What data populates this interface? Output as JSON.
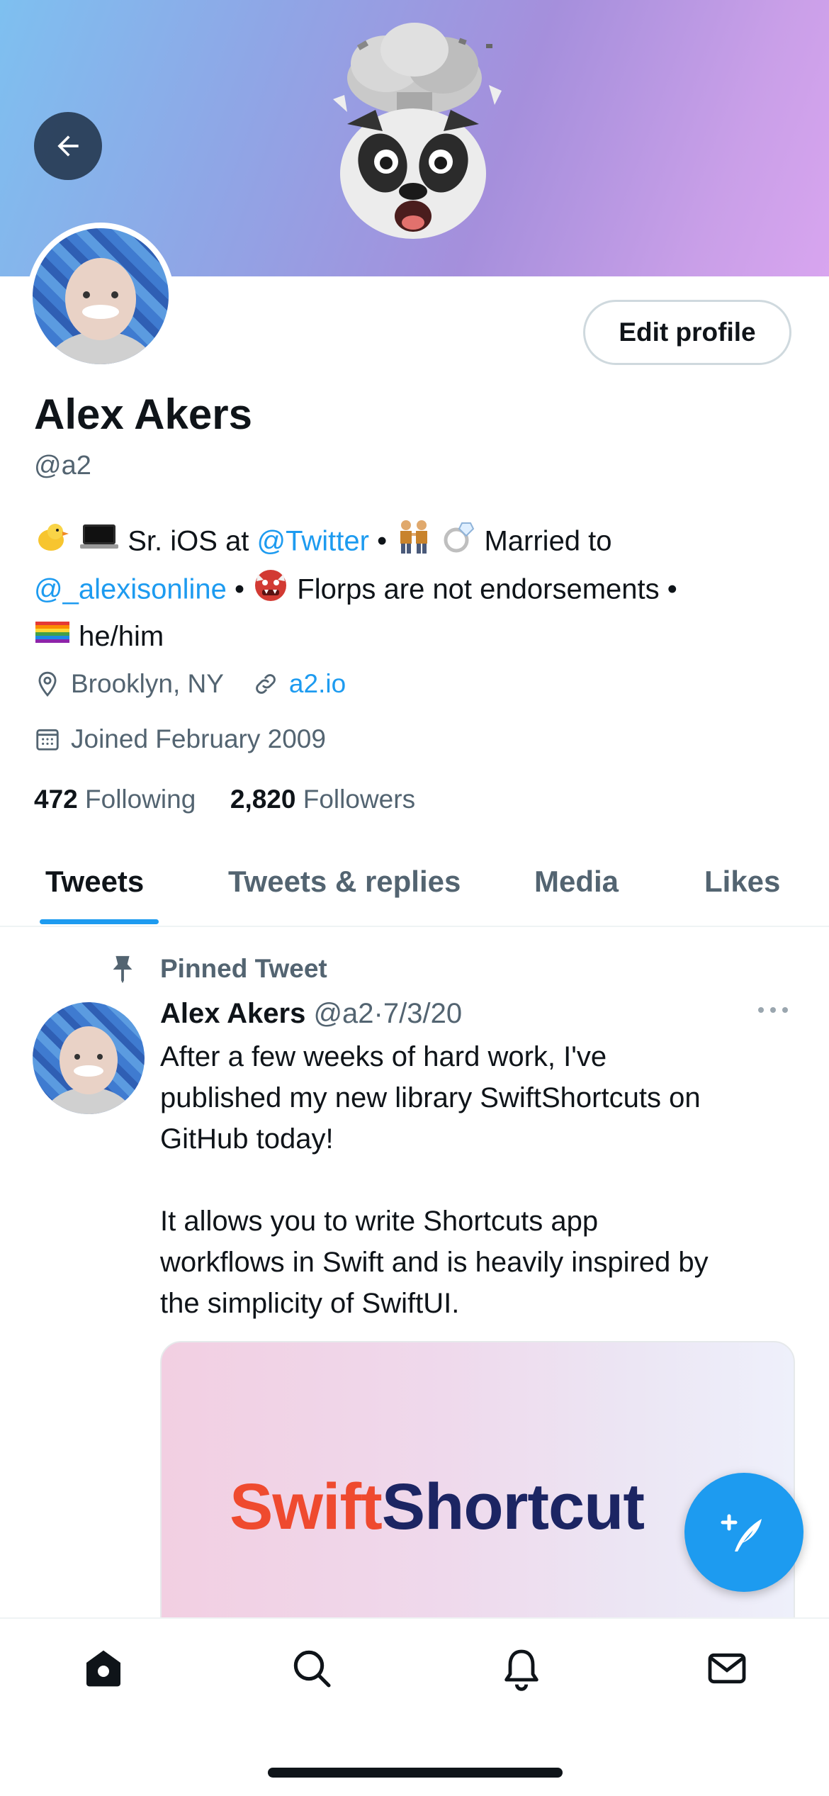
{
  "profile": {
    "name": "Alex Akers",
    "handle": "@a2",
    "edit_label": "Edit profile",
    "bio": {
      "line1_text": "Sr. iOS at",
      "line1_link": "@Twitter",
      "line1_sep": "•",
      "line1_after": "Married to",
      "line2_link": "@_alexisonline",
      "line2_sep": "•",
      "line2_text": "Florps are not endorsements •",
      "line3_text": "he/him"
    },
    "location": "Brooklyn, NY",
    "website": "a2.io",
    "joined": "Joined February 2009",
    "following_count": "472",
    "following_label": "Following",
    "followers_count": "2,820",
    "followers_label": "Followers"
  },
  "tabs": [
    {
      "label": "Tweets",
      "active": true
    },
    {
      "label": "Tweets & replies",
      "active": false
    },
    {
      "label": "Media",
      "active": false
    },
    {
      "label": "Likes",
      "active": false
    }
  ],
  "pinned_tweet": {
    "pinned_label": "Pinned Tweet",
    "author_name": "Alex Akers",
    "author_handle": "@a2",
    "separator": "·",
    "date": "7/3/20",
    "text_line1": "After a few weeks of hard work, I've",
    "text_line2": "published my new library SwiftShortcuts on",
    "text_line3": "GitHub today!",
    "text_line4": "It allows you to write Shortcuts app",
    "text_line5": "workflows in Swift and is heavily inspired by",
    "text_line6": "the simplicity of SwiftUI.",
    "card_title_part1": "Swift",
    "card_title_part2": "Shortcut"
  },
  "nav": [
    {
      "icon": "home-icon"
    },
    {
      "icon": "search-icon"
    },
    {
      "icon": "bell-icon"
    },
    {
      "icon": "mail-icon"
    }
  ],
  "colors": {
    "accent": "#1d9bf0",
    "text_primary": "#0f1419",
    "text_secondary": "#536471",
    "card_orange": "#ef4a2f",
    "card_navy": "#1c2563"
  }
}
